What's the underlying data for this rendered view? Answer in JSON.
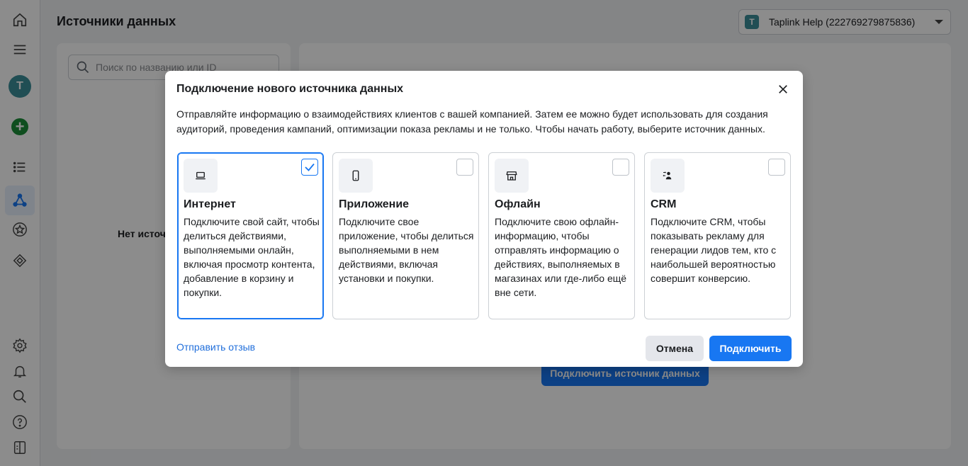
{
  "page": {
    "title": "Источники данных",
    "account": {
      "initial": "T",
      "name": "Taplink Help (222769279875836)"
    },
    "search": {
      "placeholder": "Поиск по названию или ID"
    },
    "empty_state": "Нет источников",
    "bg_connect_button": "Подключить источник данных"
  },
  "sidebar": {
    "avatar_initial": "T",
    "icons": [
      "home-icon",
      "menu-icon",
      "avatar",
      "add-icon",
      "list-icon",
      "data-sources-icon",
      "star-icon",
      "tag-icon",
      "settings-icon",
      "bell-icon",
      "search-icon",
      "help-icon",
      "panel-icon"
    ]
  },
  "modal": {
    "title": "Подключение нового источника данных",
    "description": "Отправляйте информацию о взаимодействиях клиентов с вашей компанией. Затем ее можно будет использовать для создания аудиторий, проведения кампаний, оптимизации показа рекламы и не только. Чтобы начать работу, выберите источник данных.",
    "cards": [
      {
        "icon": "laptop-icon",
        "title": "Интернет",
        "text": "Подключите свой сайт, чтобы делиться действиями, выполняемыми онлайн, включая просмотр контента, добавление в корзину и покупки.",
        "selected": true
      },
      {
        "icon": "phone-icon",
        "title": "Приложение",
        "text": "Подключите свое приложение, чтобы делиться выполняемыми в нем действиями, включая установки и покупки.",
        "selected": false
      },
      {
        "icon": "store-icon",
        "title": "Офлайн",
        "text": "Подключите свою офлайн-информацию, чтобы отправлять информацию о действиях, выполняемых в магазинах или где-либо ещё вне сети.",
        "selected": false
      },
      {
        "icon": "crm-icon",
        "title": "CRM",
        "text": "Подключите CRM, чтобы показывать рекламу для генерации лидов тем, кто с наибольшей вероятностью совершит конверсию.",
        "selected": false
      }
    ],
    "feedback_link": "Отправить отзыв",
    "cancel_button": "Отмена",
    "connect_button": "Подключить"
  },
  "colors": {
    "accent": "#1877f2",
    "link": "#216fdb",
    "avatar": "#3b8f99",
    "add": "#1c8f3a"
  }
}
